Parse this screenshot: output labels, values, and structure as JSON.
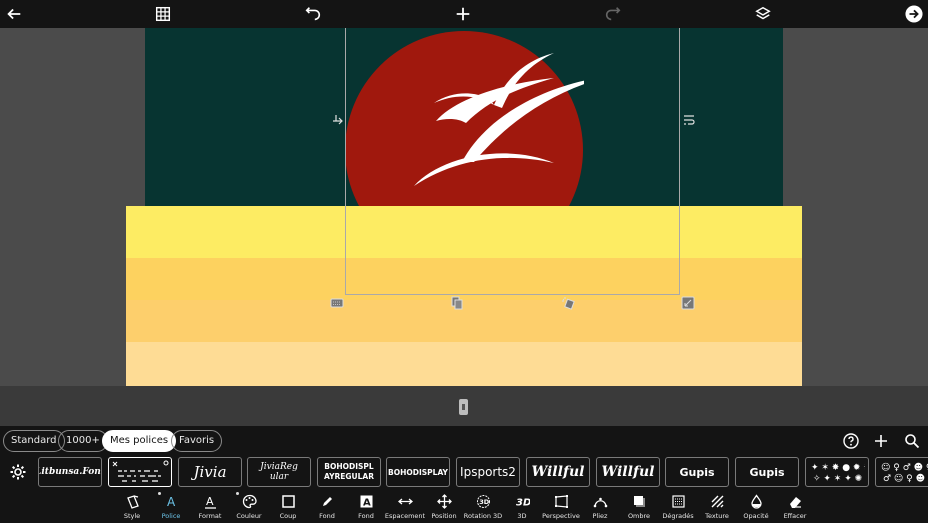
{
  "topbar": {
    "icons": [
      "back-arrow-icon",
      "grid-icon",
      "undo-icon",
      "add-icon",
      "redo-icon",
      "layers-icon",
      "next-icon"
    ]
  },
  "tabs": [
    {
      "label": "Standard",
      "active": false
    },
    {
      "label": "1000+",
      "active": false
    },
    {
      "label": "Mes polices",
      "active": true
    },
    {
      "label": "Favoris",
      "active": false
    }
  ],
  "fonts": [
    "Litbunsa.Font",
    "",
    "Jivia",
    "JiviaReg ular",
    "BOHODISPL AYREGULAR",
    "BOHODISPLAY",
    "Ipsports2",
    "Willful",
    "Willful",
    "Gupis",
    "Gupis",
    "",
    ""
  ],
  "toolbar": [
    {
      "label": "Style",
      "icon": "style-icon"
    },
    {
      "label": "Police",
      "icon": "font-icon",
      "active": true
    },
    {
      "label": "Format",
      "icon": "format-icon"
    },
    {
      "label": "Couleur",
      "icon": "palette-icon"
    },
    {
      "label": "Coup",
      "icon": "stroke-icon"
    },
    {
      "label": "Fond",
      "icon": "pen-icon"
    },
    {
      "label": "Fond",
      "icon": "background-icon"
    },
    {
      "label": "Espacement",
      "icon": "spacing-icon"
    },
    {
      "label": "Position",
      "icon": "position-icon"
    },
    {
      "label": "Rotation 3D",
      "icon": "rotation-3d-icon"
    },
    {
      "label": "3D",
      "icon": "3d-icon"
    },
    {
      "label": "Perspective",
      "icon": "perspective-icon"
    },
    {
      "label": "Pliez",
      "icon": "fold-icon"
    },
    {
      "label": "Ombre",
      "icon": "shadow-icon"
    },
    {
      "label": "Dégradés",
      "icon": "gradient-icon"
    },
    {
      "label": "Texture",
      "icon": "texture-icon"
    },
    {
      "label": "Opacité",
      "icon": "opacity-icon"
    },
    {
      "label": "Effacer",
      "icon": "eraser-icon"
    }
  ],
  "colors": {
    "sky": "#073431",
    "sun": "#a0180d",
    "stripe1": "#fdec63",
    "stripe2": "#fdd25f",
    "stripe3": "#fdcf6c",
    "stripe4": "#fedc95",
    "accent": "#6cc3e8"
  }
}
